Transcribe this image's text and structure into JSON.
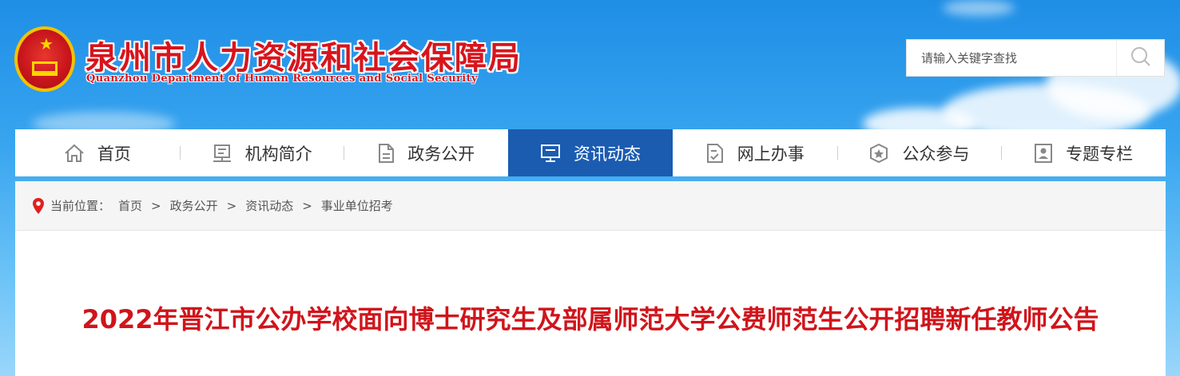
{
  "header": {
    "title_cn": "泉州市人力资源和社会保障局",
    "title_en": "Quanzhou Department of Human Resources and Social Security"
  },
  "search": {
    "placeholder": "请输入关键字查找",
    "icon": "search-icon"
  },
  "nav": {
    "items": [
      {
        "label": "首页",
        "icon": "home-icon"
      },
      {
        "label": "机构简介",
        "icon": "organization-icon"
      },
      {
        "label": "政务公开",
        "icon": "document-icon"
      },
      {
        "label": "资讯动态",
        "icon": "monitor-icon",
        "active": true
      },
      {
        "label": "网上办事",
        "icon": "checklist-icon"
      },
      {
        "label": "公众参与",
        "icon": "star-badge-icon"
      },
      {
        "label": "专题专栏",
        "icon": "profile-icon"
      }
    ]
  },
  "breadcrumb": {
    "label": "当前位置：",
    "items": [
      "首页",
      "政务公开",
      "资讯动态",
      "事业单位招考"
    ],
    "separator": ">"
  },
  "article": {
    "title": "2022年晋江市公办学校面向博士研究生及部属师范大学公费师范生公开招聘新任教师公告"
  },
  "colors": {
    "brand_red": "#d0141b",
    "nav_active": "#1b5cb1",
    "sky_blue": "#3aa6f0"
  }
}
